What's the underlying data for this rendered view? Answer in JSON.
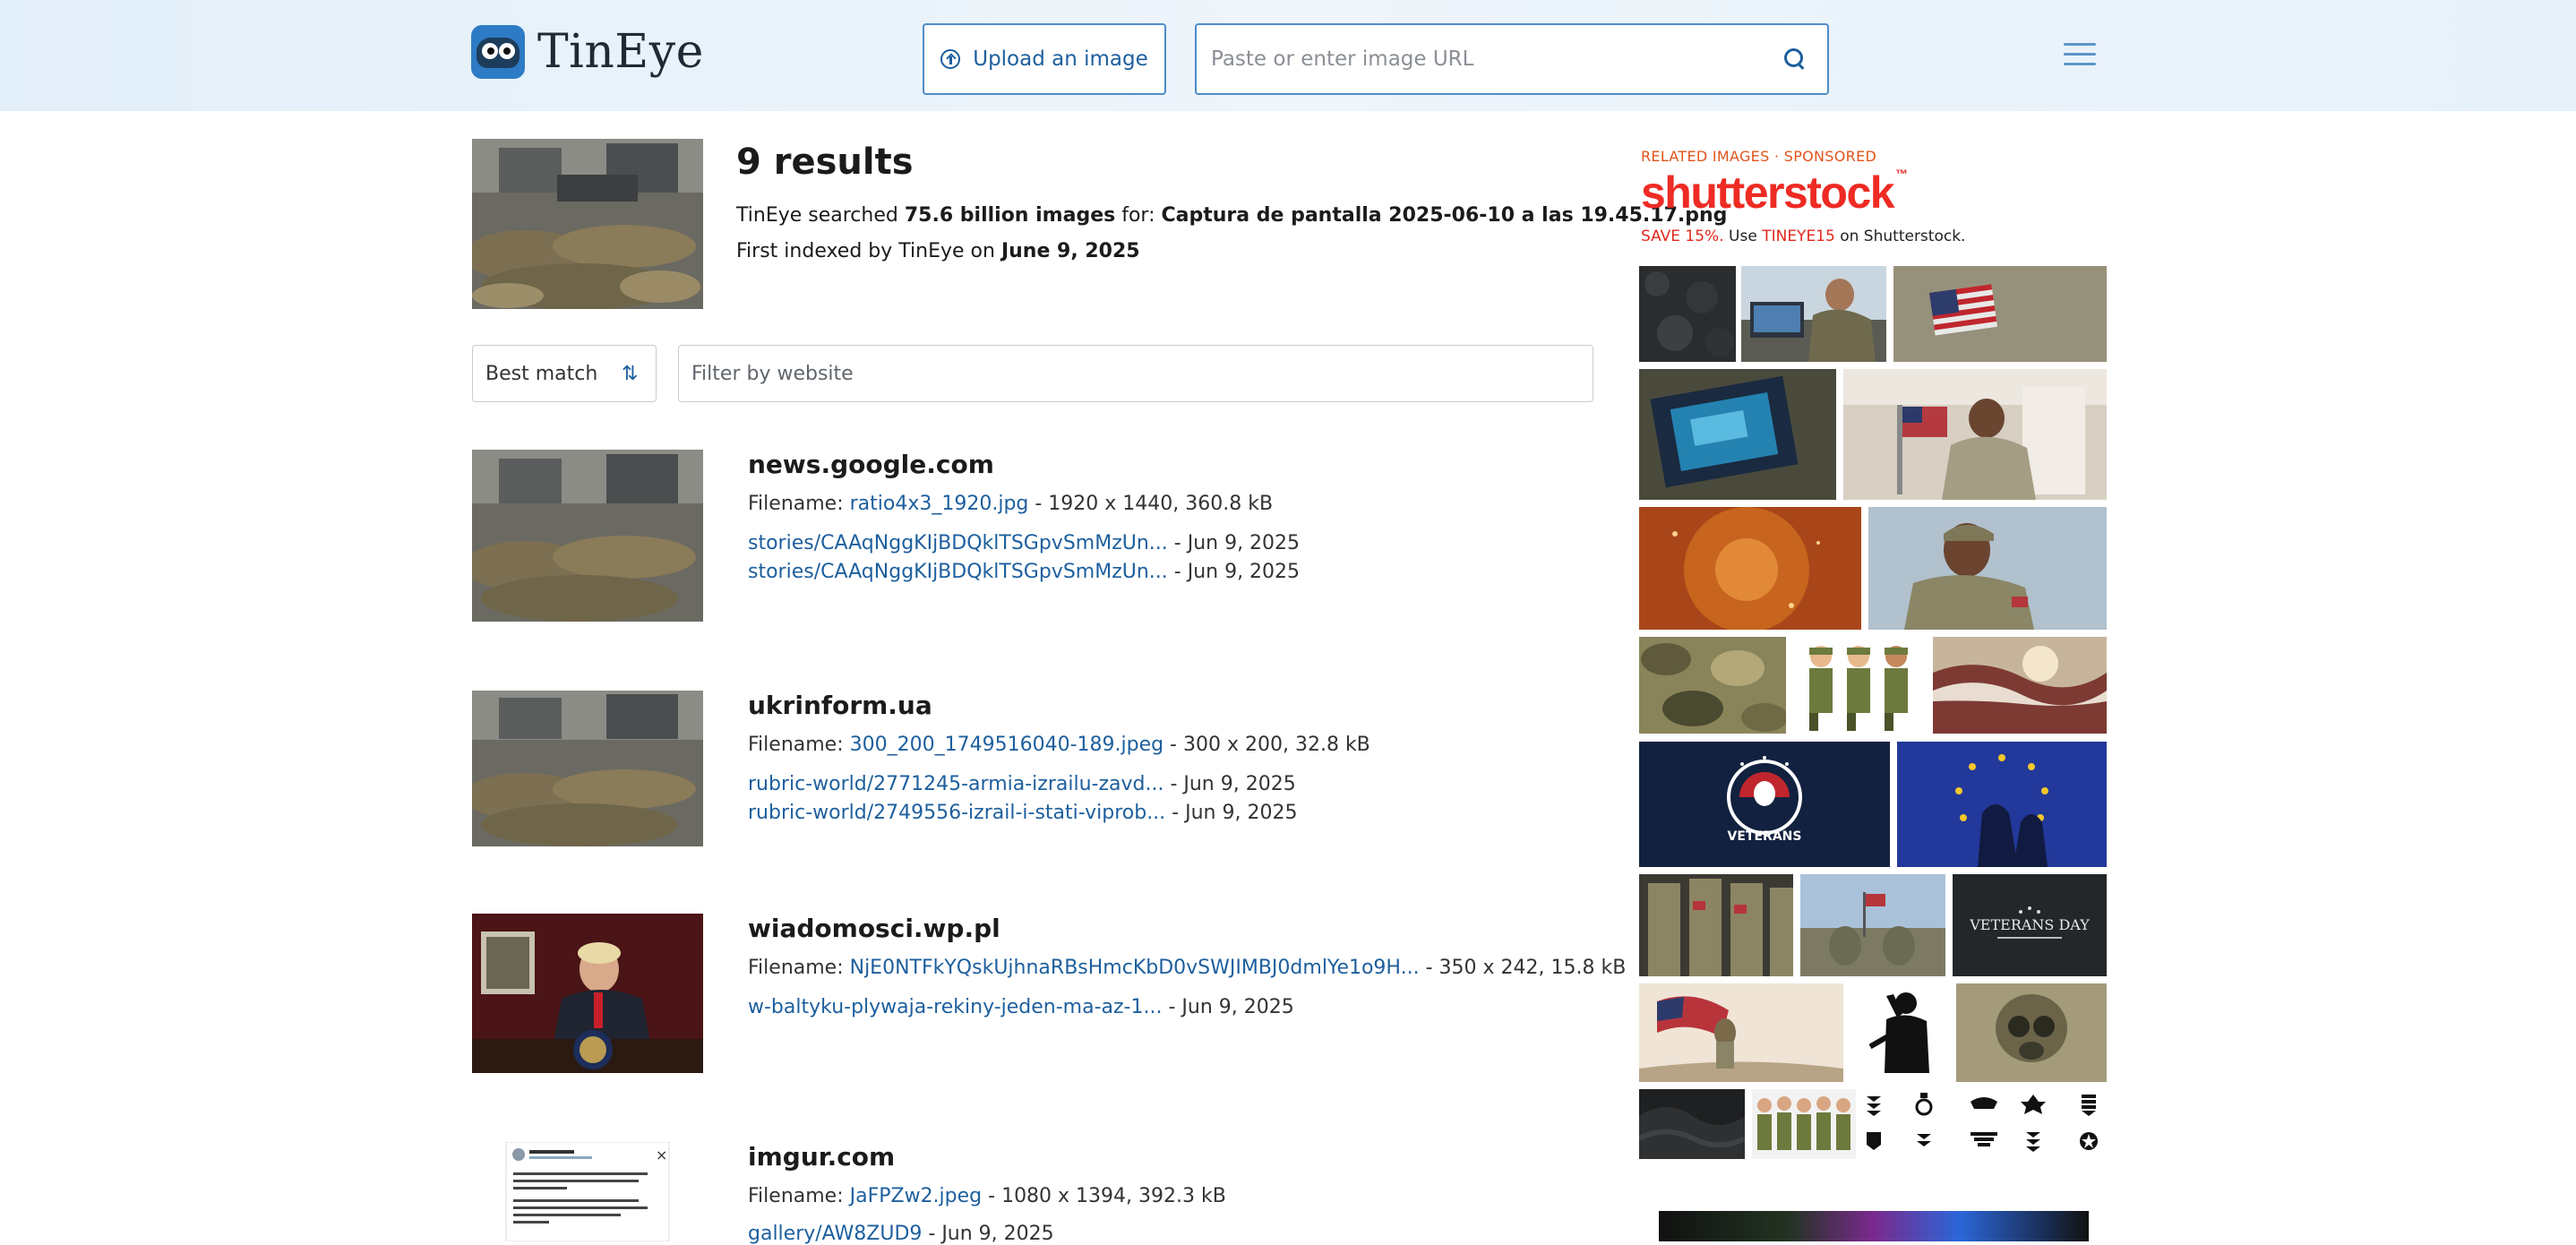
{
  "header": {
    "brand": "TinEye",
    "upload_label": "Upload an image",
    "url_placeholder": "Paste or enter image URL",
    "url_value": ""
  },
  "summary": {
    "results_count": "9 results",
    "searched_prefix": "TinEye searched ",
    "searched_amount": "75.6 billion images",
    "searched_for": " for: ",
    "query_filename": "Captura de pantalla 2025-06-10 a las 19.45.17.png",
    "indexed_prefix": "First indexed by TinEye on ",
    "indexed_date": "June 9, 2025"
  },
  "controls": {
    "sort_label": "Best match",
    "filter_placeholder": "Filter by website"
  },
  "results": [
    {
      "domain": "news.google.com",
      "filename_label": "Filename: ",
      "filename": "ratio4x3_1920.jpg",
      "meta": " - 1920 x 1440, 360.8 kB",
      "pages": [
        {
          "path": "stories/CAAqNggKIjBDQklTSGpvSmMzUn...",
          "date": " - Jun 9, 2025"
        },
        {
          "path": "stories/CAAqNggKIjBDQklTSGpvSmMzUn...",
          "date": " - Jun 9, 2025"
        }
      ]
    },
    {
      "domain": "ukrinform.ua",
      "filename_label": "Filename: ",
      "filename": "300_200_1749516040-189.jpeg",
      "meta": " - 300 x 200, 32.8 kB",
      "pages": [
        {
          "path": "rubric-world/2771245-armia-izrailu-zavd...",
          "date": " - Jun 9, 2025"
        },
        {
          "path": "rubric-world/2749556-izrail-i-stati-viprob...",
          "date": " - Jun 9, 2025"
        }
      ]
    },
    {
      "domain": "wiadomosci.wp.pl",
      "filename_label": "Filename: ",
      "filename": "NjE0NTFkYQskUjhnaRBsHmcKbD0vSWJIMBJ0dmlYe1o9H...",
      "meta": " - 350 x 242, 15.8 kB",
      "pages": [
        {
          "path": "w-baltyku-plywaja-rekiny-jeden-ma-az-1...",
          "date": " - Jun 9, 2025"
        }
      ]
    },
    {
      "domain": "imgur.com",
      "filename_label": "Filename: ",
      "filename": "JaFPZw2.jpeg",
      "meta": " - 1080 x 1394, 392.3 kB",
      "pages": [
        {
          "path": "gallery/AW8ZUD9",
          "date": " - Jun 9, 2025"
        }
      ]
    }
  ],
  "sidebar": {
    "label_related": "RELATED IMAGES",
    "label_dot": " · ",
    "label_sponsored": "SPONSORED",
    "brand": "shutterstock",
    "brand_mark": "™",
    "promo_save": "SAVE 15%.",
    "promo_use": " Use ",
    "promo_code": "TINEYE15",
    "promo_on": " on Shutterstock."
  },
  "colors": {
    "link": "#1d5f9e",
    "accent_border": "#4c8dc8",
    "shutterstock_red": "#ee2b24",
    "sponsored_orange": "#e0541b"
  },
  "icons": [
    "tineye-logo-icon",
    "upload-icon",
    "search-icon",
    "menu-icon",
    "sort-icon"
  ]
}
